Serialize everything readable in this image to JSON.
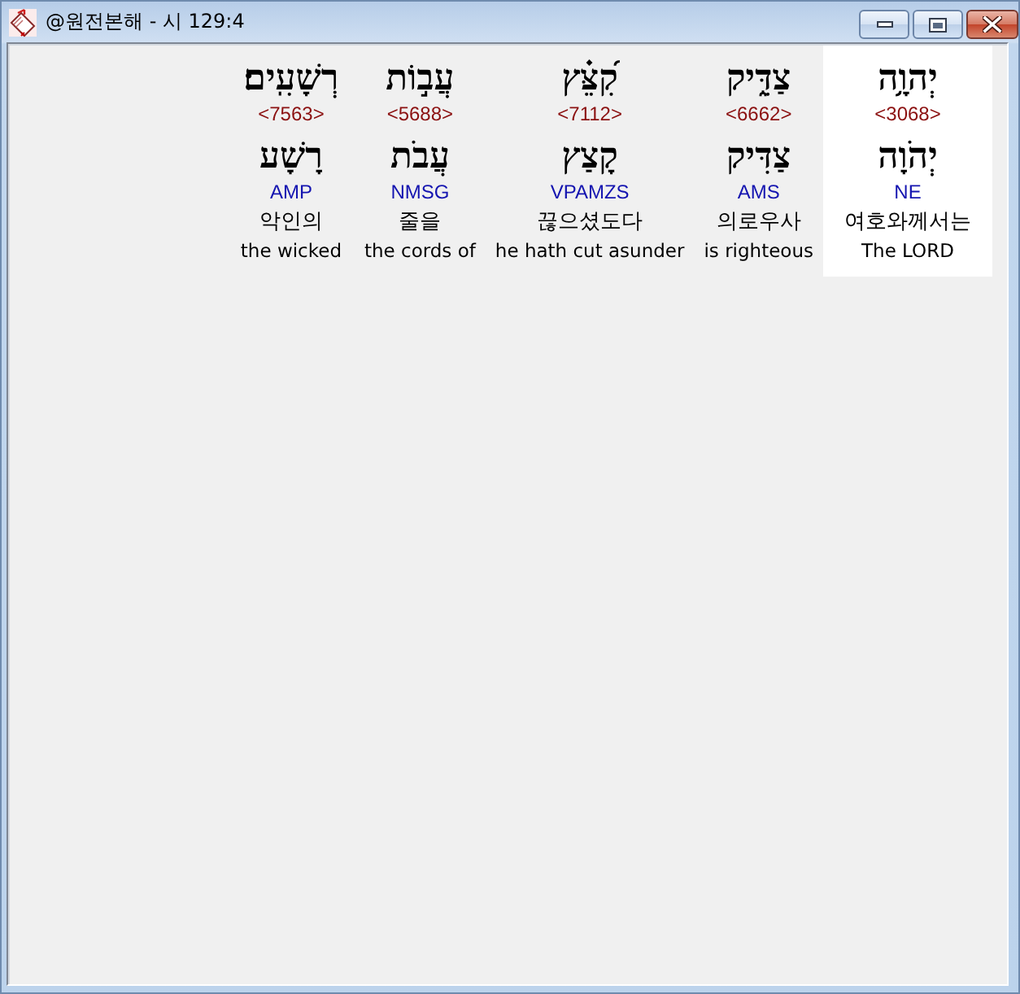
{
  "window": {
    "title": "@원전본해 - 시 129:4"
  },
  "words": [
    {
      "hebrew": "יְהוָ֥ה",
      "strongs": "<3068>",
      "lemma": "יְהֹוָה",
      "morph": "NE",
      "korean": "여호와께서는",
      "english": "The LORD",
      "selected": true
    },
    {
      "hebrew": "צַדִּ֑יק",
      "strongs": "<6662>",
      "lemma": "צַדִּיק",
      "morph": "AMS",
      "korean": "의로우사",
      "english": "is righteous",
      "selected": false
    },
    {
      "hebrew": "קִ֝צֵּ֗ץ",
      "strongs": "<7112>",
      "lemma": "קָצַץ",
      "morph": "VPAMZS",
      "korean": "끊으셨도다",
      "english": "he hath cut asunder",
      "selected": false
    },
    {
      "hebrew": "עֲב֣וֹת",
      "strongs": "<5688>",
      "lemma": "עֲבֹת",
      "morph": "NMSG",
      "korean": "줄을",
      "english": "the cords of",
      "selected": false
    },
    {
      "hebrew": "רְשָׁעִֽים׃",
      "strongs": "<7563>",
      "lemma": "רָשָׁע",
      "morph": "AMP",
      "korean": "악인의",
      "english": "the wicked",
      "selected": false
    }
  ]
}
